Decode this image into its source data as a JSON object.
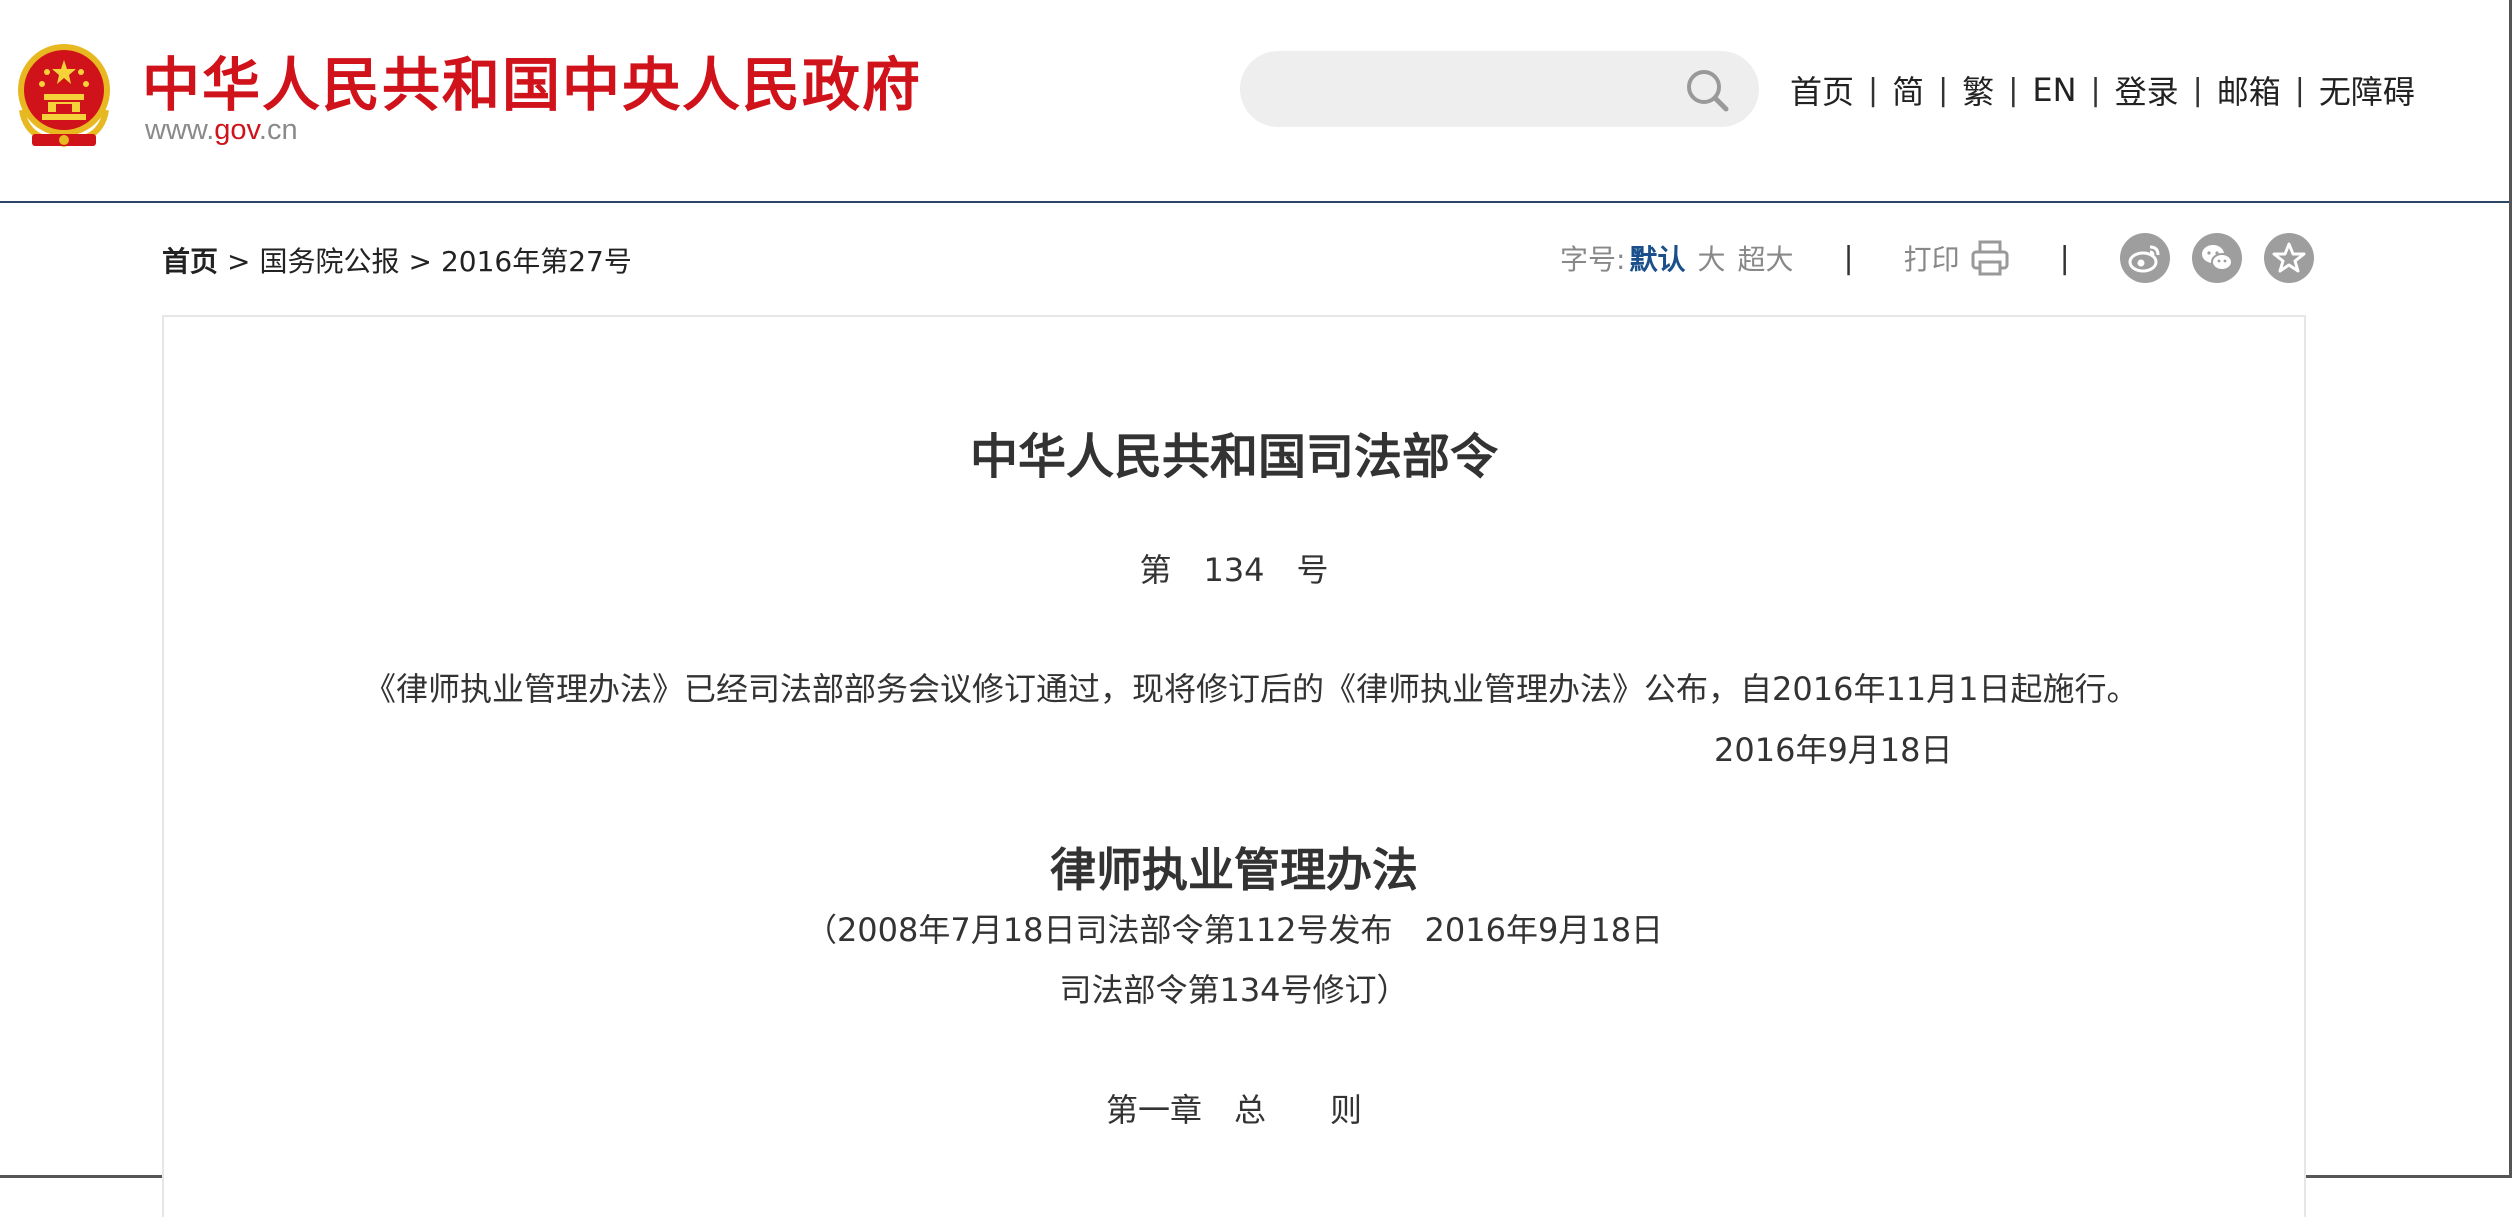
{
  "header": {
    "site_title": "中华人民共和国中央人民政府",
    "site_url_prefix": "www.",
    "site_url_highlight": "gov",
    "site_url_suffix": ".cn",
    "search_placeholder": "",
    "nav": [
      "首页",
      "简",
      "繁",
      "EN",
      "登录",
      "邮箱",
      "无障碍"
    ],
    "nav_separator": "|"
  },
  "breadcrumb": {
    "home": "首页",
    "separator": ">",
    "level1": "国务院公报",
    "level2": "2016年第27号"
  },
  "toolbar": {
    "font_size_label": "字号:",
    "font_default": "默认",
    "font_large": "大",
    "font_xlarge": "超大",
    "divider": "|",
    "print_label": "打印",
    "share_icons": [
      "weibo-icon",
      "wechat-icon",
      "favorite-icon"
    ]
  },
  "article": {
    "title": "中华人民共和国司法部令",
    "order_number": "第　134　号",
    "notice": "《律师执业管理办法》已经司法部部务会议修订通过，现将修订后的《律师执业管理办法》公布，自2016年11月1日起施行。",
    "notice_date": "2016年9月18日",
    "subtitle": "律师执业管理办法",
    "note_line1": "（2008年7月18日司法部令第112号发布　2016年9月18日",
    "note_line2": "司法部令第134号修订）",
    "chapter": "第一章　总　　则"
  },
  "colors": {
    "brand_red": "#d0121b",
    "link_blue": "#1a4f8b",
    "header_rule": "#2c4766",
    "muted_gray": "#888888",
    "share_gray": "#9e9e9e"
  }
}
